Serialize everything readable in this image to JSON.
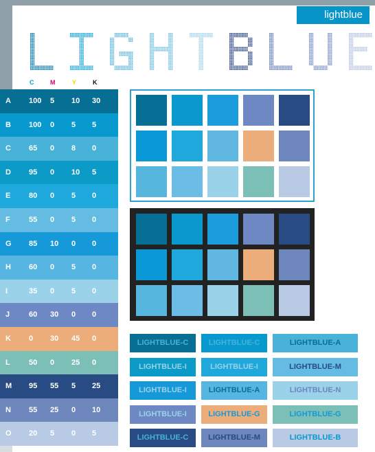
{
  "brand_tag": "lightblue",
  "title_letters": [
    {
      "char": "L",
      "color": "#0a78a8"
    },
    {
      "char": "I",
      "color": "#17a3d6"
    },
    {
      "char": "G",
      "color": "#64b8de"
    },
    {
      "char": "H",
      "color": "#75c0e2"
    },
    {
      "char": "T",
      "color": "#a5d5ee"
    },
    {
      "char": "B",
      "color": "#2f4a86"
    },
    {
      "char": "L",
      "color": "#6b83bc"
    },
    {
      "char": "U",
      "color": "#7c91c7"
    },
    {
      "char": "E",
      "color": "#b7c5e2"
    }
  ],
  "cmyk_headers": [
    {
      "label": "C",
      "color": "#00a0d6"
    },
    {
      "label": "M",
      "color": "#d4006e"
    },
    {
      "label": "Y",
      "color": "#f2d200"
    },
    {
      "label": "K",
      "color": "#111111"
    }
  ],
  "rows": [
    {
      "id": "A",
      "c": "100",
      "m": "5",
      "y": "10",
      "k": "30",
      "color": "#076f94"
    },
    {
      "id": "B",
      "c": "100",
      "m": "0",
      "y": "5",
      "k": "5",
      "color": "#0899cf"
    },
    {
      "id": "C",
      "c": "65",
      "m": "0",
      "y": "8",
      "k": "0",
      "color": "#48b2d9"
    },
    {
      "id": "D",
      "c": "95",
      "m": "0",
      "y": "10",
      "k": "5",
      "color": "#0b9bc6"
    },
    {
      "id": "E",
      "c": "80",
      "m": "0",
      "y": "5",
      "k": "0",
      "color": "#1fa8dc"
    },
    {
      "id": "F",
      "c": "55",
      "m": "0",
      "y": "5",
      "k": "0",
      "color": "#64bce3"
    },
    {
      "id": "G",
      "c": "85",
      "m": "10",
      "y": "0",
      "k": "0",
      "color": "#1699d8"
    },
    {
      "id": "H",
      "c": "60",
      "m": "0",
      "y": "5",
      "k": "0",
      "color": "#56b6e1"
    },
    {
      "id": "I",
      "c": "35",
      "m": "0",
      "y": "5",
      "k": "0",
      "color": "#9ad2ea"
    },
    {
      "id": "J",
      "c": "60",
      "m": "30",
      "y": "0",
      "k": "0",
      "color": "#6e88c4"
    },
    {
      "id": "K",
      "c": "0",
      "m": "30",
      "y": "45",
      "k": "0",
      "color": "#ecad7a"
    },
    {
      "id": "L",
      "c": "50",
      "m": "0",
      "y": "25",
      "k": "0",
      "color": "#7bbfb6"
    },
    {
      "id": "M",
      "c": "95",
      "m": "55",
      "y": "5",
      "k": "25",
      "color": "#274b82"
    },
    {
      "id": "N",
      "c": "55",
      "m": "25",
      "y": "0",
      "k": "10",
      "color": "#6d86bc"
    },
    {
      "id": "O",
      "c": "20",
      "m": "5",
      "y": "0",
      "k": "5",
      "color": "#b8cae4"
    }
  ],
  "palette_grid": [
    [
      "#066f96",
      "#0a98cf",
      "#1c9cdc",
      "#6e88c4",
      "#274b82"
    ],
    [
      "#0a98d6",
      "#1fa8dc",
      "#60b8e2",
      "#ecad7a",
      "#6d86bc"
    ],
    [
      "#57b6dd",
      "#6bbde6",
      "#9ad2ea",
      "#7bbfb6",
      "#b8cae4"
    ]
  ],
  "chips": [
    {
      "label": "LIGHTBLUE-C",
      "bg": "#076f94",
      "fg": "#48b2d9"
    },
    {
      "label": "LIGHTBLUE-C",
      "bg": "#0899cf",
      "fg": "#48b2d9"
    },
    {
      "label": "LIGHTBLUE-A",
      "bg": "#48b2d9",
      "fg": "#076f94"
    },
    {
      "label": "LIGHTBLUE-I",
      "bg": "#0b9bc6",
      "fg": "#9ad2ea"
    },
    {
      "label": "LIGHTBLUE-I",
      "bg": "#1fa8dc",
      "fg": "#9ad2ea"
    },
    {
      "label": "LIGHTBLUE-M",
      "bg": "#64bce3",
      "fg": "#274b82"
    },
    {
      "label": "LIGHTBLUE-I",
      "bg": "#1699d8",
      "fg": "#9ad2ea"
    },
    {
      "label": "LIGHTBLUE-A",
      "bg": "#56b6e1",
      "fg": "#076f94"
    },
    {
      "label": "LIGHTBLUE-N",
      "bg": "#9ad2ea",
      "fg": "#6d86bc"
    },
    {
      "label": "LIGHTBLUE-I",
      "bg": "#6e88c4",
      "fg": "#9ad2ea"
    },
    {
      "label": "LIGHTBLUE-G",
      "bg": "#ecad7a",
      "fg": "#1699d8"
    },
    {
      "label": "LIGHTBLUE-G",
      "bg": "#7bbfb6",
      "fg": "#1699d8"
    },
    {
      "label": "LIGHTBLUE-C",
      "bg": "#274b82",
      "fg": "#48b2d9"
    },
    {
      "label": "LIGHTBLUE-M",
      "bg": "#6d86bc",
      "fg": "#274b82"
    },
    {
      "label": "LIGHTBLUE-B",
      "bg": "#b8cae4",
      "fg": "#0899cf"
    }
  ]
}
